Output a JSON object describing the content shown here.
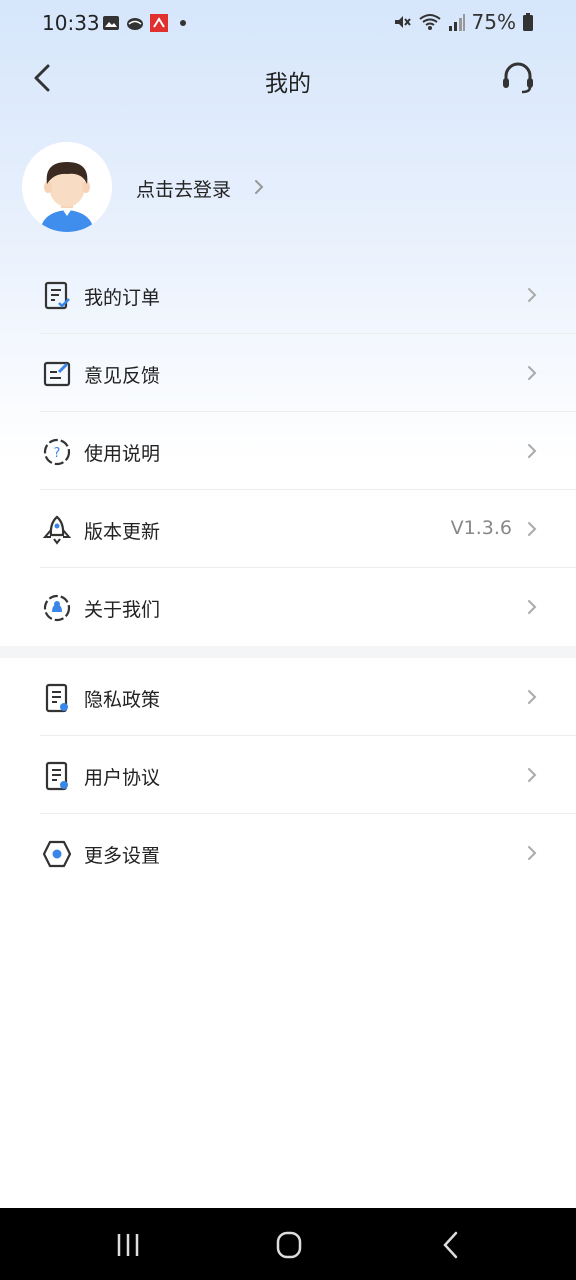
{
  "status": {
    "time": "10:33",
    "battery": "75%",
    "left_icons": [
      "gallery-icon",
      "cloud-icon",
      "app-icon",
      "dot-icon"
    ],
    "right_icons": [
      "mute-icon",
      "wifi-icon",
      "signal-icon",
      "battery-icon"
    ]
  },
  "header": {
    "title": "我的",
    "back_icon": "chevron-left-icon",
    "support_icon": "headset-icon"
  },
  "profile": {
    "login_label": "点击去登录"
  },
  "menu_group_1": [
    {
      "label": "我的订单",
      "icon": "order-icon",
      "value": ""
    },
    {
      "label": "意见反馈",
      "icon": "feedback-icon",
      "value": ""
    },
    {
      "label": "使用说明",
      "icon": "help-icon",
      "value": ""
    },
    {
      "label": "版本更新",
      "icon": "rocket-icon",
      "value": "V1.3.6"
    },
    {
      "label": "关于我们",
      "icon": "about-icon",
      "value": ""
    }
  ],
  "menu_group_2": [
    {
      "label": "隐私政策",
      "icon": "privacy-doc-icon",
      "value": ""
    },
    {
      "label": "用户协议",
      "icon": "agreement-doc-icon",
      "value": ""
    },
    {
      "label": "更多设置",
      "icon": "settings-hex-icon",
      "value": ""
    }
  ],
  "colors": {
    "accent": "#3a86e8",
    "background_top": "#d6e6fb",
    "separator": "#ececec"
  }
}
